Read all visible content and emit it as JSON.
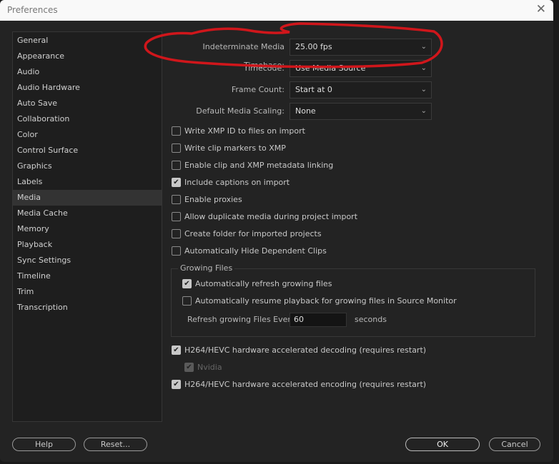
{
  "window": {
    "title": "Preferences"
  },
  "sidebar": {
    "items": [
      "General",
      "Appearance",
      "Audio",
      "Audio Hardware",
      "Auto Save",
      "Collaboration",
      "Color",
      "Control Surface",
      "Graphics",
      "Labels",
      "Media",
      "Media Cache",
      "Memory",
      "Playback",
      "Sync Settings",
      "Timeline",
      "Trim",
      "Transcription"
    ],
    "selected": "Media"
  },
  "fields": [
    {
      "label": "Indeterminate Media Timebase:",
      "value": "25.00 fps"
    },
    {
      "label": "Timecode:",
      "value": "Use Media Source"
    },
    {
      "label": "Frame Count:",
      "value": "Start at 0"
    },
    {
      "label": "Default Media Scaling:",
      "value": "None"
    }
  ],
  "checkboxes": [
    {
      "label": "Write XMP ID to files on import",
      "checked": false
    },
    {
      "label": "Write clip markers to XMP",
      "checked": false
    },
    {
      "label": "Enable clip and XMP metadata linking",
      "checked": false
    },
    {
      "label": "Include captions on import",
      "checked": true
    },
    {
      "label": "Enable proxies",
      "checked": false
    },
    {
      "label": "Allow duplicate media during project import",
      "checked": false
    },
    {
      "label": "Create folder for imported projects",
      "checked": false
    },
    {
      "label": "Automatically Hide Dependent Clips",
      "checked": false
    }
  ],
  "growing": {
    "title": "Growing Files",
    "refresh": {
      "label": "Automatically refresh growing files",
      "checked": true
    },
    "resume": {
      "label": "Automatically resume playback for growing files in Source Monitor",
      "checked": false
    },
    "every_label": "Refresh growing Files Every",
    "every_value": "60",
    "unit": "seconds"
  },
  "hw": {
    "decoding": {
      "label": "H264/HEVC hardware accelerated decoding (requires restart)",
      "checked": true
    },
    "nvidia": {
      "label": "Nvidia",
      "checked": true,
      "disabled": true
    },
    "encoding": {
      "label": "H264/HEVC hardware accelerated encoding (requires restart)",
      "checked": true
    }
  },
  "buttons": {
    "help": "Help",
    "reset": "Reset...",
    "ok": "OK",
    "cancel": "Cancel"
  },
  "annotation_color": "#d0161b"
}
